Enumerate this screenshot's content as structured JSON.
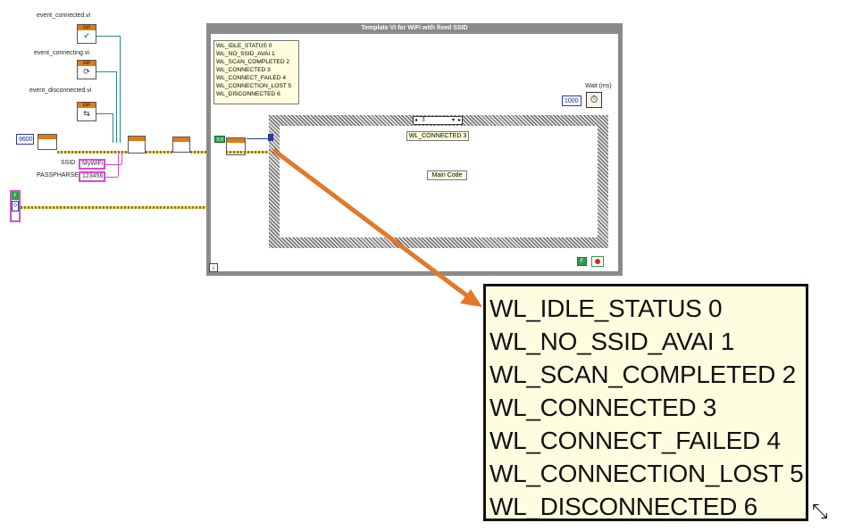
{
  "subvi_labels": {
    "connected": "event_connected.vi",
    "connecting": "event_connecting.vi",
    "disconnected": "event_disconnected.vi"
  },
  "controls": {
    "baud": "9600",
    "ssid_label": "SSID",
    "ssid_value": "MyWiFi",
    "passphrase_label": "PASSPHARSE",
    "passphrase_value": "123456",
    "bool_label": "F",
    "err_value": "0"
  },
  "loop": {
    "title": "Template VI for WiFi with fixed SSID",
    "iteration": "i",
    "wait_label": "Wait (ms)",
    "wait_value": "1000",
    "stop_const": "F",
    "loop_const": "3.0"
  },
  "case": {
    "selector": "3",
    "case_label": "WL_CONNECTED 3",
    "main_code": "Main Code"
  },
  "status_list": [
    "WL_IDLE_STATUS 0",
    "WL_NO_SSID_AVAI 1",
    "WL_SCAN_COMPLETED 2",
    "WL_CONNECTED 3",
    "WL_CONNECT_FAILED 4",
    "WL_CONNECTION_LOST 5",
    "WL_DISCONNECTED 6"
  ],
  "colors": {
    "arrow": "#e07a2a",
    "note_bg": "#fffde0",
    "loop_border": "#8a8a8a"
  }
}
